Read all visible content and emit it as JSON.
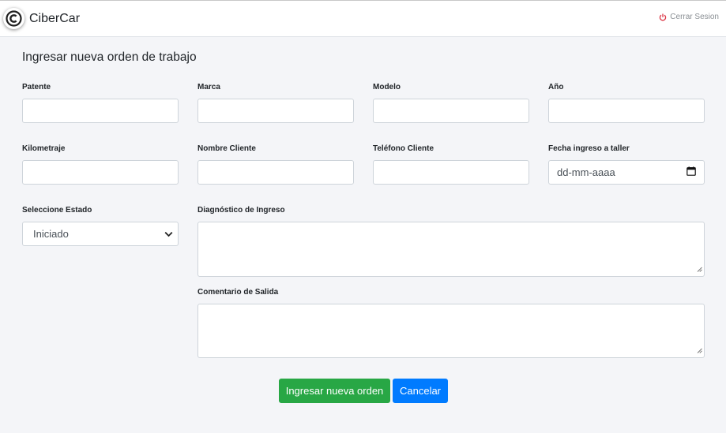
{
  "navbar": {
    "brand": "CiberCar",
    "logo_icon": "copyright-c-icon",
    "logout_label": "Cerrar Sesion",
    "logout_icon": "power-icon",
    "logout_color": "#dc3545"
  },
  "form": {
    "title": "Ingresar nueva orden de trabajo",
    "patente": {
      "label": "Patente",
      "value": ""
    },
    "marca": {
      "label": "Marca",
      "value": ""
    },
    "modelo": {
      "label": "Modelo",
      "value": ""
    },
    "anio": {
      "label": "Año",
      "value": ""
    },
    "kilometraje": {
      "label": "Kilometraje",
      "value": ""
    },
    "nombre_cliente": {
      "label": "Nombre Cliente",
      "value": ""
    },
    "telefono_cliente": {
      "label": "Teléfono Cliente",
      "value": ""
    },
    "fecha_ingreso": {
      "label": "Fecha ingreso a taller",
      "placeholder": "dd-mm-aaaa"
    },
    "estado": {
      "label": "Seleccione Estado",
      "selected": "Iniciado"
    },
    "diagnostico": {
      "label": "Diagnóstico de Ingreso",
      "value": ""
    },
    "comentario": {
      "label": "Comentario de Salida",
      "value": ""
    }
  },
  "actions": {
    "submit_label": "Ingresar nueva orden",
    "cancel_label": "Cancelar",
    "submit_color": "#28a745",
    "cancel_color": "#007bff"
  }
}
